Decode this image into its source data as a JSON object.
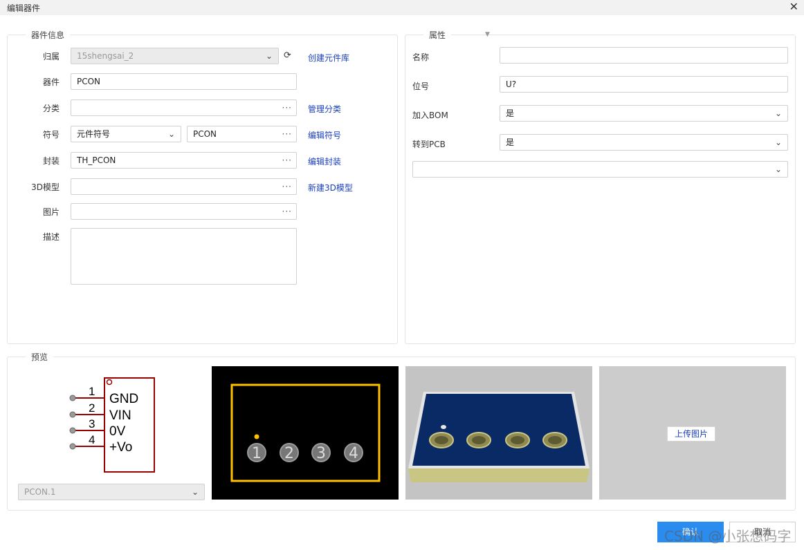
{
  "window": {
    "title": "编辑器件",
    "close_glyph": "✕"
  },
  "component_info": {
    "legend": "器件信息",
    "owner": {
      "label": "归属",
      "value": "15shengsai_2",
      "link": "创建元件库"
    },
    "device": {
      "label": "器件",
      "value": "PCON"
    },
    "category": {
      "label": "分类",
      "value": "",
      "link": "管理分类"
    },
    "symbol": {
      "label": "符号",
      "type_value": "元件符号",
      "value": "PCON",
      "link": "编辑符号"
    },
    "footprint": {
      "label": "封装",
      "value": "TH_PCON",
      "link": "编辑封装"
    },
    "model3d": {
      "label": "3D模型",
      "value": "",
      "link": "新建3D模型"
    },
    "image": {
      "label": "图片",
      "value": ""
    },
    "description": {
      "label": "描述",
      "value": ""
    }
  },
  "attributes": {
    "legend": "属性",
    "name": {
      "label": "名称",
      "value": ""
    },
    "designator": {
      "label": "位号",
      "value": "U?"
    },
    "add_bom": {
      "label": "加入BOM",
      "value": "是"
    },
    "to_pcb": {
      "label": "转到PCB",
      "value": "是"
    },
    "extra_select": {
      "value": ""
    }
  },
  "preview": {
    "legend": "预览",
    "symbol_pins": [
      {
        "num": "1",
        "name": "GND"
      },
      {
        "num": "2",
        "name": "VIN"
      },
      {
        "num": "3",
        "name": "0V"
      },
      {
        "num": "4",
        "name": "+Vo"
      }
    ],
    "footprint_pads": [
      "1",
      "2",
      "3",
      "4"
    ],
    "symbol_select": "PCON.1",
    "upload_label": "上传图片"
  },
  "buttons": {
    "ok": "确认",
    "cancel": "取消"
  },
  "watermark": "CSDN @小张想码字",
  "colors": {
    "link": "#1a3fbf",
    "primary": "#2b8cf0",
    "symbol_outline": "#990000",
    "silkscreen": "#ffc000",
    "board": "#0a2a66"
  },
  "icons": {
    "dots": "···",
    "caret": "⌄",
    "refresh": "⟳"
  }
}
